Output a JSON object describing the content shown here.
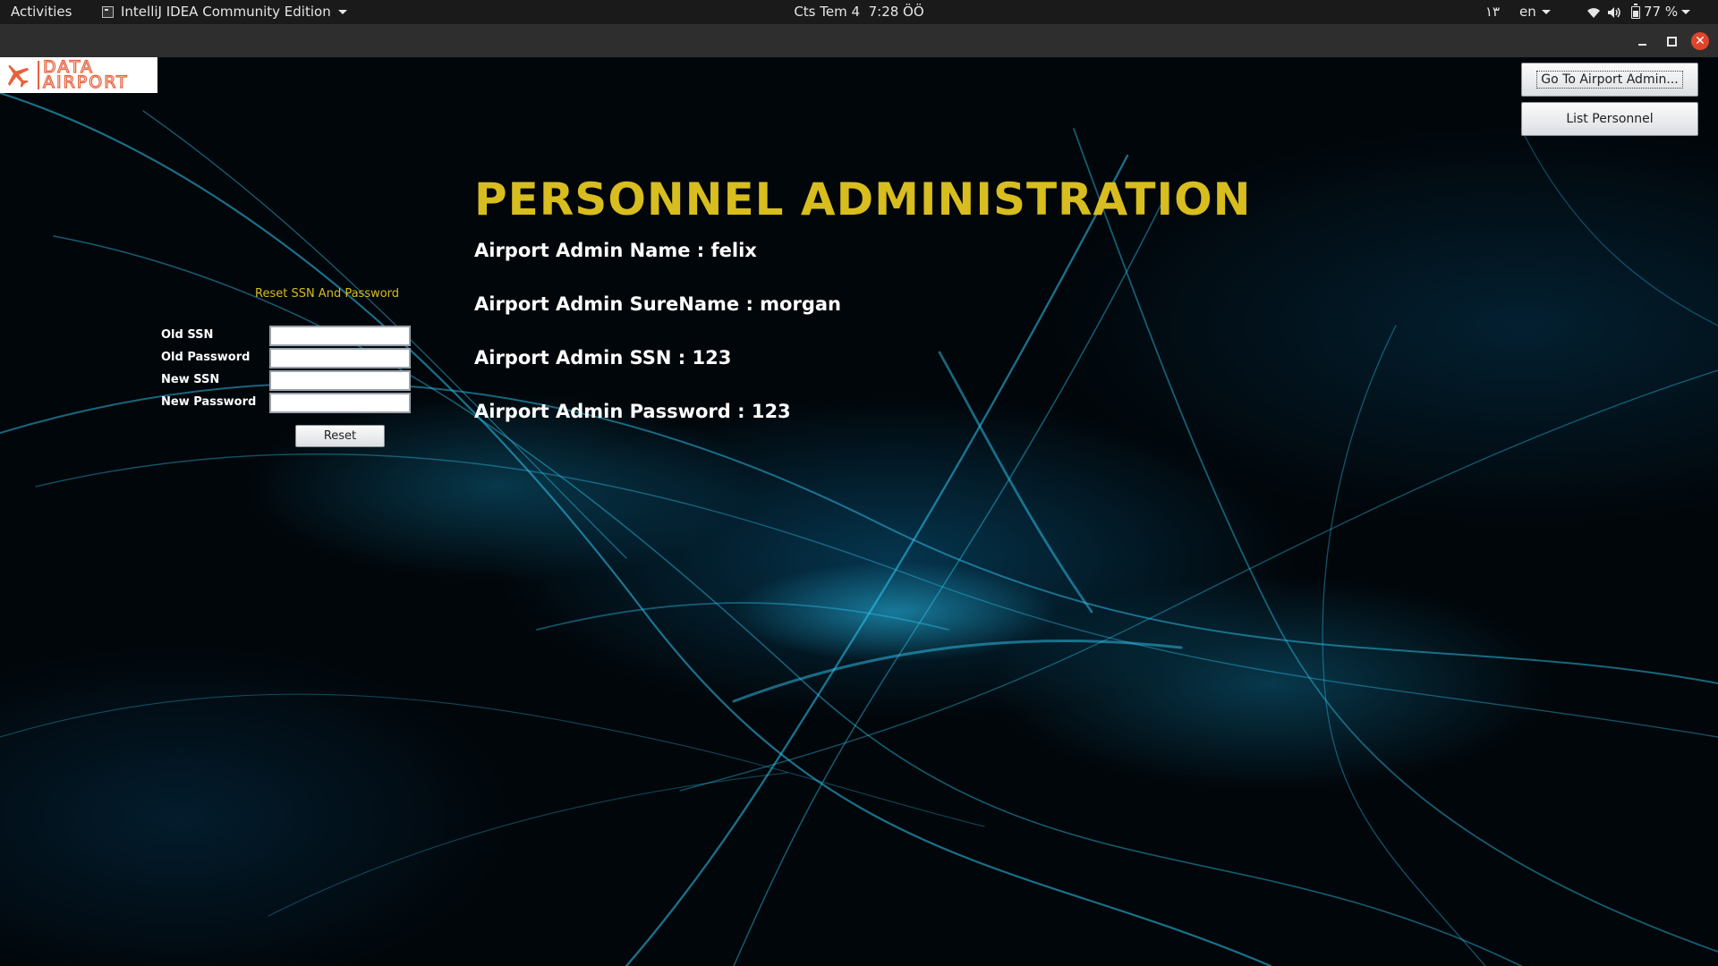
{
  "topbar": {
    "activities": "Activities",
    "app_name": "IntelliJ IDEA Community Edition",
    "clock_day": "Cts Tem 4",
    "clock_time": "7:28 ÖÖ",
    "indicator_number": "١٣",
    "language": "en",
    "battery": "77 %"
  },
  "icons": {
    "app": "intellij-app-icon",
    "wifi": "wifi-icon",
    "volume": "volume-icon",
    "battery": "battery-icon",
    "plane": "airplane-icon"
  },
  "window": {
    "minimize": "minimize",
    "maximize": "maximize",
    "close": "close"
  },
  "logo": {
    "line1": "DATA",
    "line2": "AIRPORT",
    "color": "#e8613d"
  },
  "buttons": {
    "goto_admin": "Go To Airport Admin...",
    "list_personnel": "List Personnel",
    "reset": "Reset"
  },
  "page": {
    "title": "PERSONNEL ADMINISTRATION",
    "title_color": "#d8bd1f",
    "admin_name": "Airport Admin Name : felix",
    "admin_surname": "Airport Admin SureName : morgan",
    "admin_ssn": "Airport Admin SSN : 123",
    "admin_password": "Airport Admin Password : 123"
  },
  "reset_form": {
    "title": "Reset SSN And Password",
    "old_ssn_label": "Old SSN",
    "old_ssn_value": "",
    "old_password_label": "Old Password",
    "old_password_value": "",
    "new_ssn_label": "New SSN",
    "new_ssn_value": "",
    "new_password_label": "New Password",
    "new_password_value": ""
  }
}
